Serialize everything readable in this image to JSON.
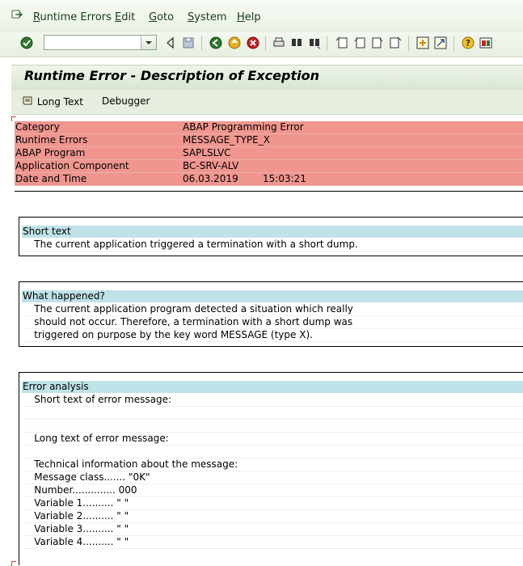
{
  "menubar": {
    "items": [
      "Runtime Errors",
      "Edit",
      "Goto",
      "System",
      "Help"
    ],
    "mnemonics": [
      "R",
      "E",
      "G",
      "S",
      "H"
    ]
  },
  "toolbar": {
    "command_field_value": "",
    "icons": [
      "enter-icon",
      "back-icon",
      "save-icon",
      "nav-back-icon",
      "exit-icon",
      "cancel-icon",
      "print-icon",
      "find-icon",
      "find-next-icon",
      "first-page-icon",
      "previous-page-icon",
      "next-page-icon",
      "last-page-icon",
      "create-session-icon",
      "shortcut-icon",
      "help-icon",
      "customize-layout-icon"
    ]
  },
  "title": "Runtime Error - Description of Exception",
  "app_toolbar": {
    "long_text_label": "Long Text",
    "debugger_label": "Debugger"
  },
  "header_info": [
    {
      "label": "Category",
      "value": "ABAP Programming Error"
    },
    {
      "label": "Runtime Errors",
      "value": "MESSAGE_TYPE_X"
    },
    {
      "label": "ABAP Program",
      "value": "SAPLSLVC"
    },
    {
      "label": "Application Component",
      "value": "BC-SRV-ALV"
    },
    {
      "label": "Date and Time",
      "value": "06.03.2019",
      "value2": "15:03:21"
    }
  ],
  "sections": {
    "short_text": {
      "title": "Short text",
      "lines": [
        "    The current application triggered a termination with a short dump."
      ]
    },
    "what_happened": {
      "title": "What happened?",
      "lines": [
        "    The current application program detected a situation which really",
        "    should not occur. Therefore, a termination with a short dump was",
        "    triggered on purpose by the key word MESSAGE (type X)."
      ]
    },
    "error_analysis": {
      "title": "Error analysis",
      "lines": [
        "    Short text of error message:",
        "",
        "",
        "    Long text of error message:",
        "",
        "    Technical information about the message:",
        "    Message class....... \"0K\"",
        "    Number.............. 000",
        "    Variable 1.......... \" \"",
        "    Variable 2.......... \" \"",
        "    Variable 3.......... \" \"",
        "    Variable 4.......... \" \""
      ]
    }
  },
  "colors": {
    "header_row_bg": "#f0968f",
    "section_header_bg": "#bfe2e8",
    "chrome_green": "#e6eee0"
  }
}
